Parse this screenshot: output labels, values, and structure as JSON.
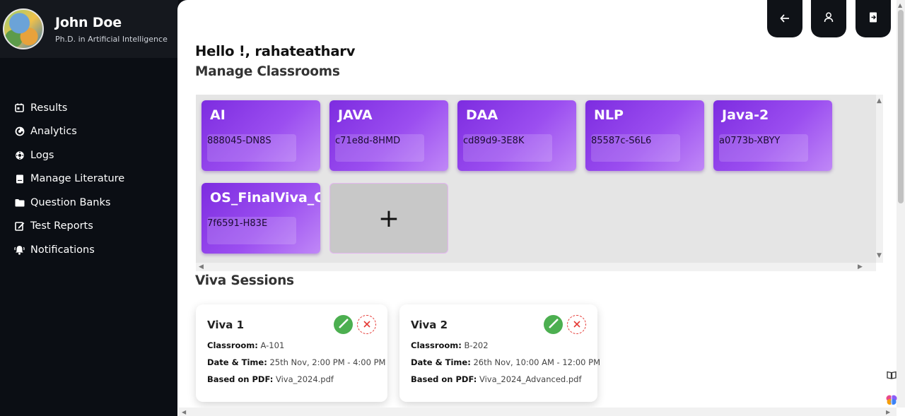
{
  "profile": {
    "name": "John Doe",
    "subtitle": "Ph.D. in Artificial Intelligence"
  },
  "sidebar": {
    "items": [
      {
        "label": "Results",
        "icon": "calendar-icon"
      },
      {
        "label": "Analytics",
        "icon": "analytics-icon"
      },
      {
        "label": "Logs",
        "icon": "gear-icon"
      },
      {
        "label": "Manage Literature",
        "icon": "document-icon"
      },
      {
        "label": "Question Banks",
        "icon": "folder-icon"
      },
      {
        "label": "Test Reports",
        "icon": "edit-icon"
      },
      {
        "label": "Notifications",
        "icon": "bell-icon"
      }
    ]
  },
  "top_buttons": [
    {
      "name": "back",
      "icon": "arrow-left-icon"
    },
    {
      "name": "profile",
      "icon": "user-icon"
    },
    {
      "name": "logout",
      "icon": "logout-icon"
    }
  ],
  "main": {
    "greeting": "Hello !, rahateatharv",
    "classrooms_title": "Manage Classrooms",
    "classrooms": [
      {
        "name": "AI",
        "code": "888045-DN8S"
      },
      {
        "name": "JAVA",
        "code": "c71e8d-8HMD"
      },
      {
        "name": "DAA",
        "code": "cd89d9-3E8K"
      },
      {
        "name": "NLP",
        "code": "85587c-S6L6"
      },
      {
        "name": "Java-2",
        "code": "a0773b-XBYY"
      },
      {
        "name": "OS_FinalViva_O",
        "code": "7f6591-H83E"
      }
    ],
    "add_label": "+",
    "viva_title": "Viva Sessions",
    "vivas": [
      {
        "title": "Viva 1",
        "classroom_label": "Classroom:",
        "classroom": "A-101",
        "datetime_label": "Date & Time:",
        "datetime": "25th Nov, 2:00 PM - 4:00 PM",
        "pdf_label": "Based on PDF:",
        "pdf": "Viva_2024.pdf"
      },
      {
        "title": "Viva 2",
        "classroom_label": "Classroom:",
        "classroom": "B-202",
        "datetime_label": "Date & Time:",
        "datetime": "26th Nov, 10:00 AM - 12:00 PM",
        "pdf_label": "Based on PDF:",
        "pdf": "Viva_2024_Advanced.pdf"
      }
    ]
  },
  "colors": {
    "sidebar_bg": "#0b0e14",
    "card_gradient_start": "#7d2ce0",
    "card_gradient_end": "#c088f7",
    "edit_green": "#4caf50",
    "delete_red": "#e53935"
  }
}
